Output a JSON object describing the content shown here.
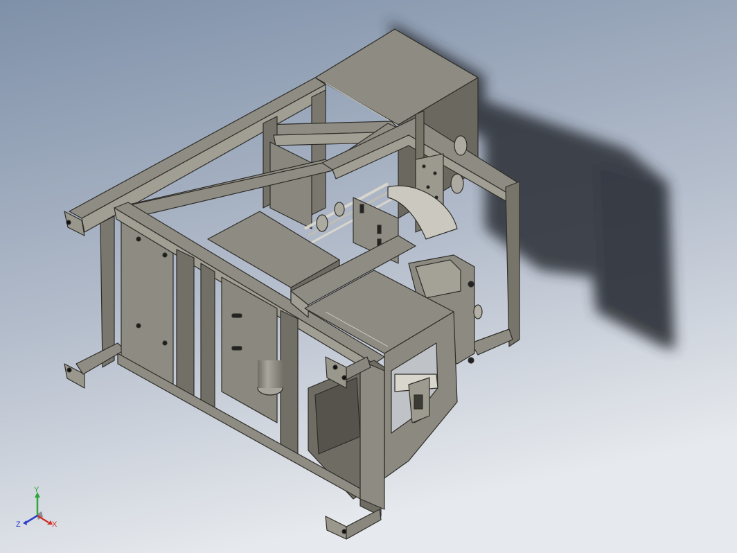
{
  "app": {
    "view": "isometric-3d-model"
  },
  "colors": {
    "background_top": "#7f91a9",
    "background_bottom": "#dfe3e8",
    "frame_top": "#8d8b81",
    "frame_side_light": "#9d9b90",
    "frame_side_dark": "#6a685f",
    "frame_edge": "#2d2c28",
    "panel_face": "#8f8d83",
    "shadow": "#2b2f36"
  },
  "triad": {
    "x_label": "X",
    "y_label": "Y",
    "z_label": "Z",
    "x_color": "#d0302a",
    "y_color": "#2fa53a",
    "z_color": "#2b3fc8"
  }
}
